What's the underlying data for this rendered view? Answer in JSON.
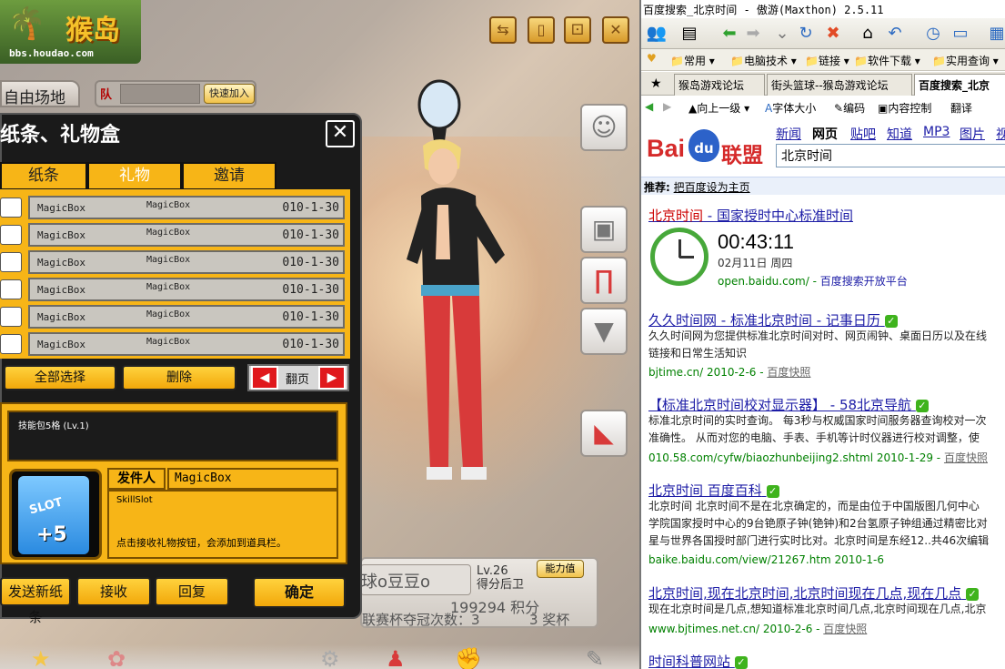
{
  "game": {
    "logo": {
      "main": "猴岛",
      "sub": "bbs.houdao.com"
    },
    "top_buttons": [
      "⇆",
      "▯",
      "⚀",
      "✕"
    ],
    "stadium_label": "自由场地",
    "team_label": "队",
    "quick_join": "快速加入",
    "dialog": {
      "title": "纸条、礼物盒",
      "close": "✕",
      "tabs": [
        "纸条",
        "礼物",
        "邀请"
      ],
      "active_tab": "礼物",
      "rows": [
        {
          "name": "MagicBox",
          "item": "MagicBox",
          "date": "010-1-30"
        },
        {
          "name": "MagicBox",
          "item": "MagicBox",
          "date": "010-1-30"
        },
        {
          "name": "MagicBox",
          "item": "MagicBox",
          "date": "010-1-30"
        },
        {
          "name": "MagicBox",
          "item": "MagicBox",
          "date": "010-1-30"
        },
        {
          "name": "MagicBox",
          "item": "MagicBox",
          "date": "010-1-30"
        },
        {
          "name": "MagicBox",
          "item": "MagicBox",
          "date": "010-1-30"
        }
      ],
      "select_all": "全部选择",
      "delete": "删除",
      "page_turn": "翻页",
      "desc": "技能包5格 (Lv.1)",
      "slot_label": "SLOT",
      "slot_count": "+5",
      "sender_label": "发件人",
      "sender_value": "MagicBox",
      "msg_line1": "SkillSlot",
      "msg_line2": "点击接收礼物按钮，会添加到道具栏。",
      "btn_send": "发送新纸条",
      "btn_receive": "接收",
      "btn_reply": "回复",
      "btn_ok": "确定"
    },
    "stats": {
      "name": "球o豆豆o",
      "level": "Lv.26",
      "position": "得分后卫",
      "power": "能力值",
      "score": "199294 积分",
      "cup_text": "联赛杯夺冠次数：3",
      "cups": "3 奖杯"
    }
  },
  "browser": {
    "title": "百度搜索_北京时间 - 傲游(Maxthon) 2.5.11",
    "favorites": [
      "常用",
      "电脑技术",
      "链接",
      "软件下载",
      "实用查询"
    ],
    "tabs": [
      "猴岛游戏论坛",
      "街头篮球--猴岛游戏论坛",
      "百度搜索_北京"
    ],
    "nav": {
      "up": "向上一级",
      "font": "字体大小",
      "encoding": "编码",
      "content": "内容控制",
      "translate": "翻译"
    },
    "baidu": {
      "logo_bai": "Bai",
      "logo_du": "du",
      "logo_union": "联盟",
      "nav": [
        "新闻",
        "网页",
        "贴吧",
        "知道",
        "MP3",
        "图片",
        "视"
      ],
      "nav_active": "网页",
      "query": "北京时间",
      "recommend_label": "推荐:",
      "recommend_link": "把百度设为主页"
    },
    "results": [
      {
        "title_a": "北京时间",
        "title_b": " - 国家授时中心标准时间",
        "time": "00:43:11",
        "date": "02月11日 周四",
        "url": "open.baidu.com/",
        "extra": "百度搜索开放平台"
      },
      {
        "title": "久久时间网 - 标准北京时间 - 记事日历",
        "text1": "久久时间网为您提供标准北京时间对时、网页闹钟、桌面日历以及在线",
        "text2": "链接和日常生活知识",
        "url": "bjtime.cn/ 2010-2-6 - ",
        "cache": "百度快照"
      },
      {
        "title": "【标准北京时间校对显示器】 - 58北京导航",
        "text1": "标准北京时间的实时查询。 每3秒与权威国家时间服务器查询校对一次",
        "text2": "准确性。 从而对您的电脑、手表、手机等计时仪器进行校对调整，使",
        "url": "010.58.com/cyfw/biaozhunbeijing2.shtml 2010-1-29 - ",
        "cache": "百度快照"
      },
      {
        "title": "北京时间 百度百科",
        "text1": "北京时间 北京时间不是在北京确定的，而是由位于中国版图几何中心",
        "text2": "学院国家授时中心的9台铯原子钟(铯钟)和2台氢原子钟组通过精密比对",
        "text3": "星与世界各国授时部门进行实时比对。北京时间是东经12..共46次编辑",
        "url": "baike.baidu.com/view/21267.htm 2010-1-6"
      },
      {
        "title": "北京时间,现在北京时间,北京时间现在几点,现在几点",
        "text1": "现在北京时间是几点,想知道标准北京时间几点,北京时间现在几点,北京",
        "url": "www.bjtimes.net.cn/ 2010-2-6 - ",
        "cache": "百度快照"
      },
      {
        "title": "时间科普网站"
      }
    ]
  }
}
